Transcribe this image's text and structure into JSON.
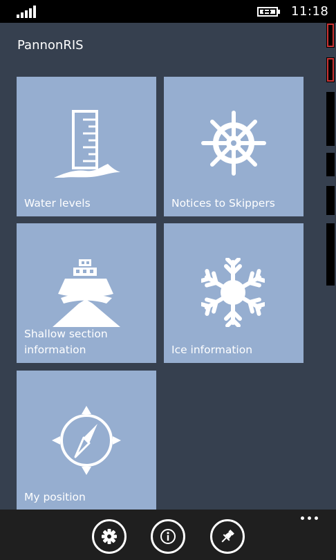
{
  "status": {
    "time": "11:18",
    "signal_icon": "signal-bars-icon",
    "battery_icon": "battery-charging-icon"
  },
  "app": {
    "title": "PannonRIS"
  },
  "tiles": [
    {
      "label": "Water levels",
      "icon": "water-gauge-icon"
    },
    {
      "label": "Notices to Skippers",
      "icon": "ship-wheel-icon"
    },
    {
      "label": "Shallow section information",
      "icon": "ship-icon"
    },
    {
      "label": "Ice information",
      "icon": "snowflake-icon"
    },
    {
      "label": "My position",
      "icon": "compass-icon"
    }
  ],
  "app_bar": {
    "buttons": [
      {
        "icon": "settings-gear-icon"
      },
      {
        "icon": "info-icon"
      },
      {
        "icon": "pin-icon"
      }
    ],
    "more_icon": "ellipsis-icon"
  },
  "colors": {
    "background": "#36404f",
    "tile": "#96aed0",
    "status_bar": "#000000",
    "app_bar": "#1f1f1f"
  }
}
